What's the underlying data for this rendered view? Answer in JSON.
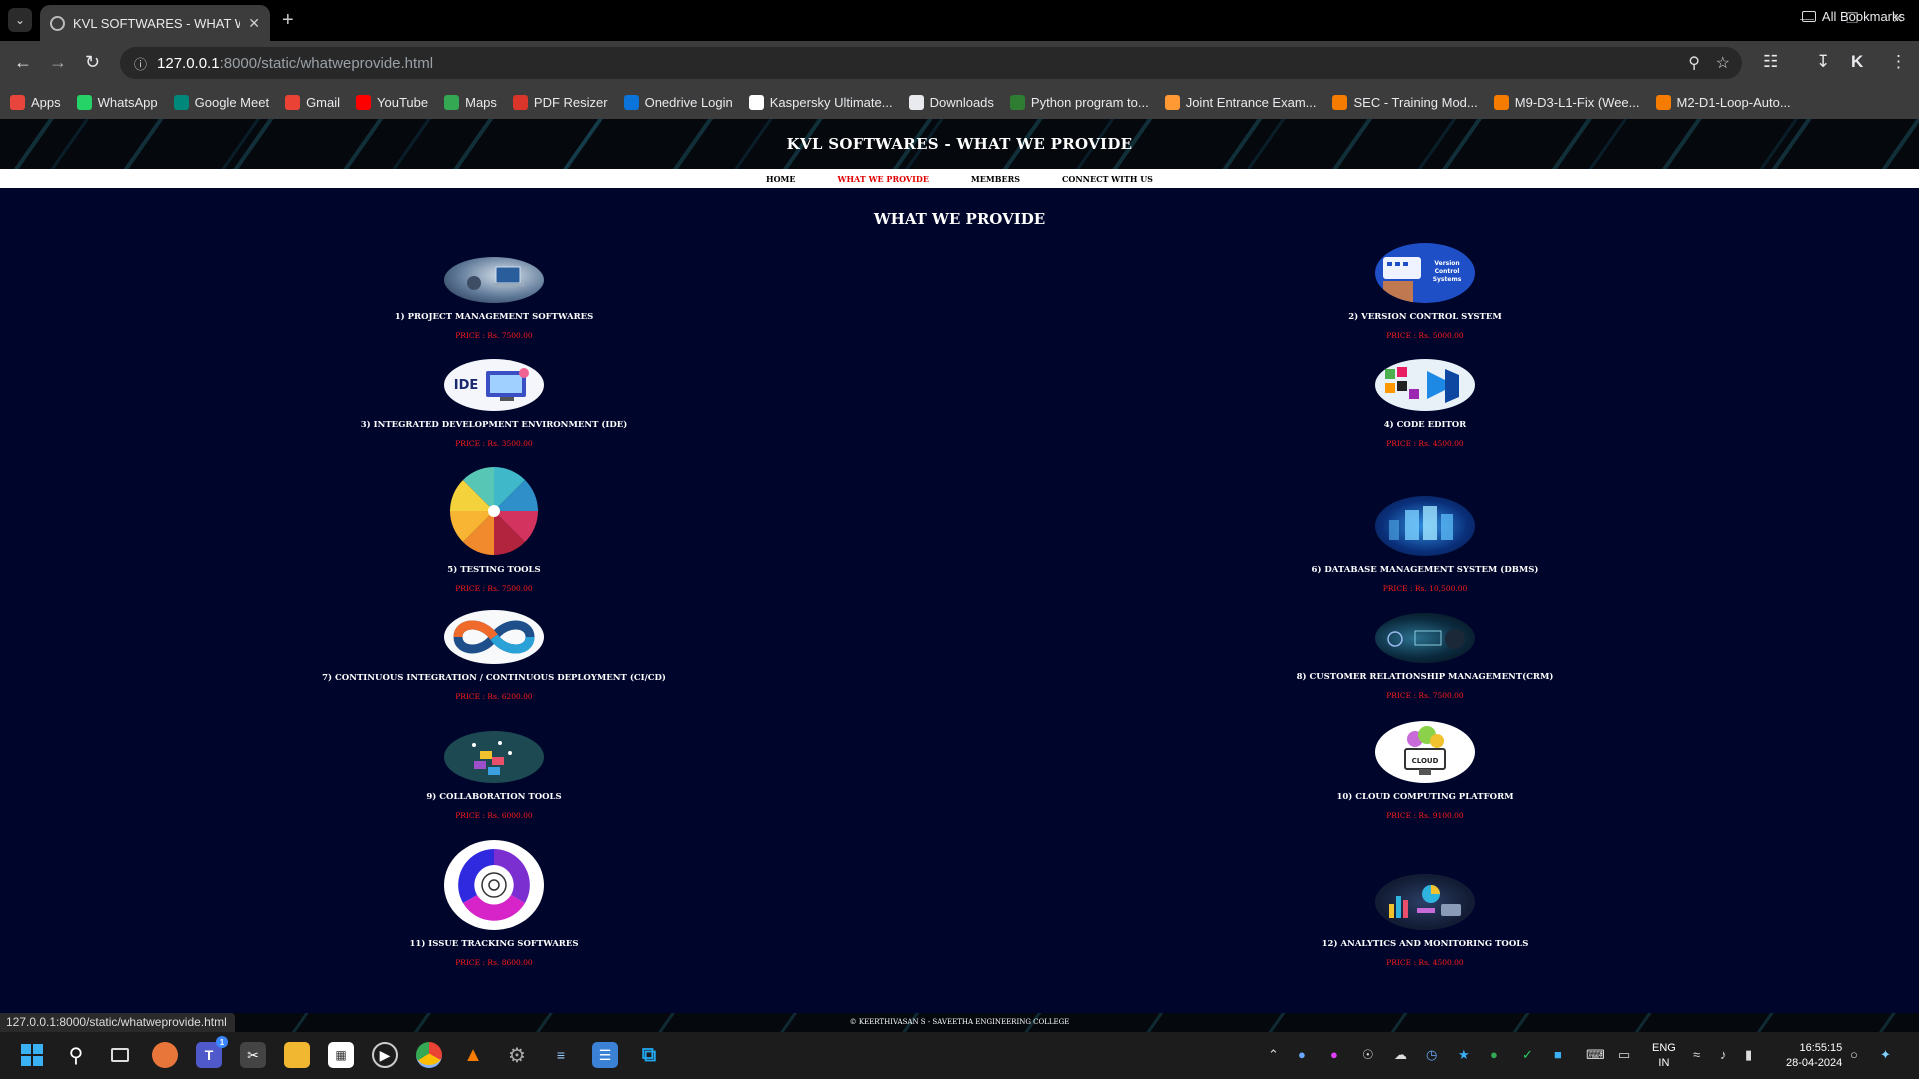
{
  "browser": {
    "tab_title": "KVL SOFTWARES - WHAT WE PROVIDE",
    "url_host": "127.0.0.1",
    "url_rest": ":8000/static/whatweprovide.html",
    "status_url": "127.0.0.1:8000/static/whatweprovide.html",
    "bookmarks": [
      {
        "label": "Apps",
        "icon": "apps-grid-icon",
        "color": "#e8453c"
      },
      {
        "label": "WhatsApp",
        "icon": "whatsapp-icon",
        "color": "#25d366"
      },
      {
        "label": "Google Meet",
        "icon": "meet-icon",
        "color": "#00897b"
      },
      {
        "label": "Gmail",
        "icon": "gmail-icon",
        "color": "#ea4335"
      },
      {
        "label": "YouTube",
        "icon": "youtube-icon",
        "color": "#ff0000"
      },
      {
        "label": "Maps",
        "icon": "maps-icon",
        "color": "#34a853"
      },
      {
        "label": "PDF Resizer",
        "icon": "pdf-resizer-icon",
        "color": "#d9352a"
      },
      {
        "label": "Onedrive Login",
        "icon": "onedrive-icon",
        "color": "#0a74da"
      },
      {
        "label": "Kaspersky Ultimate...",
        "icon": "amazon-icon",
        "color": "#ffffff"
      },
      {
        "label": "Downloads",
        "icon": "download-icon",
        "color": "#e8eaed"
      },
      {
        "label": "Python program to...",
        "icon": "python-icon",
        "color": "#2e7d32"
      },
      {
        "label": "Joint Entrance Exam...",
        "icon": "india-flag-icon",
        "color": "#ff9933"
      },
      {
        "label": "SEC - Training Mod...",
        "icon": "sec-icon",
        "color": "#f57c00"
      },
      {
        "label": "M9-D3-L1-Fix (Wee...",
        "icon": "sec-icon",
        "color": "#f57c00"
      },
      {
        "label": "M2-D1-Loop-Auto...",
        "icon": "sec-icon",
        "color": "#f57c00"
      }
    ],
    "all_bookmarks": "All Bookmarks"
  },
  "site": {
    "title": "KVL SOFTWARES - WHAT WE PROVIDE",
    "nav": [
      "HOME",
      "WHAT WE PROVIDE",
      "MEMBERS",
      "CONNECT WITH US"
    ],
    "active_nav": "WHAT WE PROVIDE",
    "heading": "WHAT WE PROVIDE",
    "footer": "© KEERTHIVASAN S - SAVEETHA ENGINEERING COLLEGE",
    "accent_price": "#ff1a1a",
    "background": "#00062b"
  },
  "products": [
    {
      "name": "1) PROJECT MANAGEMENT SOFTWARES",
      "price": "PRICE : Rs. 7500.00",
      "image": "project-management-image"
    },
    {
      "name": "2) VERSION CONTROL SYSTEM",
      "price": "PRICE : Rs. 5000.00",
      "image": "version-control-image",
      "image_text": "Version Control Systems"
    },
    {
      "name": "3) INTEGRATED DEVELOPMENT ENVIRONMENT (IDE)",
      "price": "PRICE : Rs. 3500.00",
      "image": "ide-image",
      "image_text": "IDE"
    },
    {
      "name": "4) CODE EDITOR",
      "price": "PRICE : Rs. 4500.00",
      "image": "code-editor-image"
    },
    {
      "name": "5) TESTING TOOLS",
      "price": "PRICE : Rs. 7500.00",
      "image": "testing-tools-wheel-image"
    },
    {
      "name": "6) DATABASE MANAGEMENT SYSTEM (DBMS)",
      "price": "PRICE : Rs. 10,500.00",
      "image": "dbms-image"
    },
    {
      "name": "7) CONTINUOUS INTEGRATION / CONTINUOUS DEPLOYMENT (CI/CD)",
      "price": "PRICE : Rs. 6200.00",
      "image": "cicd-loop-image"
    },
    {
      "name": "8) CUSTOMER RELATIONSHIP MANAGEMENT(CRM)",
      "price": "PRICE : Rs. 7500.00",
      "image": "crm-image"
    },
    {
      "name": "9) COLLABORATION TOOLS",
      "price": "PRICE : Rs. 6000.00",
      "image": "collaboration-image"
    },
    {
      "name": "10) CLOUD COMPUTING PLATFORM",
      "price": "PRICE : Rs. 9100.00",
      "image": "cloud-image",
      "image_text": "CLOUD"
    },
    {
      "name": "11) ISSUE TRACKING SOFTWARES",
      "price": "PRICE : Rs. 8600.00",
      "image": "issue-tracking-image"
    },
    {
      "name": "12) ANALYTICS AND MONITORING TOOLS",
      "price": "PRICE : Rs. 4500.00",
      "image": "analytics-image"
    }
  ],
  "taskbar": {
    "language": "ENG",
    "region": "IN",
    "time": "16:55:15",
    "date": "28-04-2024",
    "teams_badge": "1"
  }
}
